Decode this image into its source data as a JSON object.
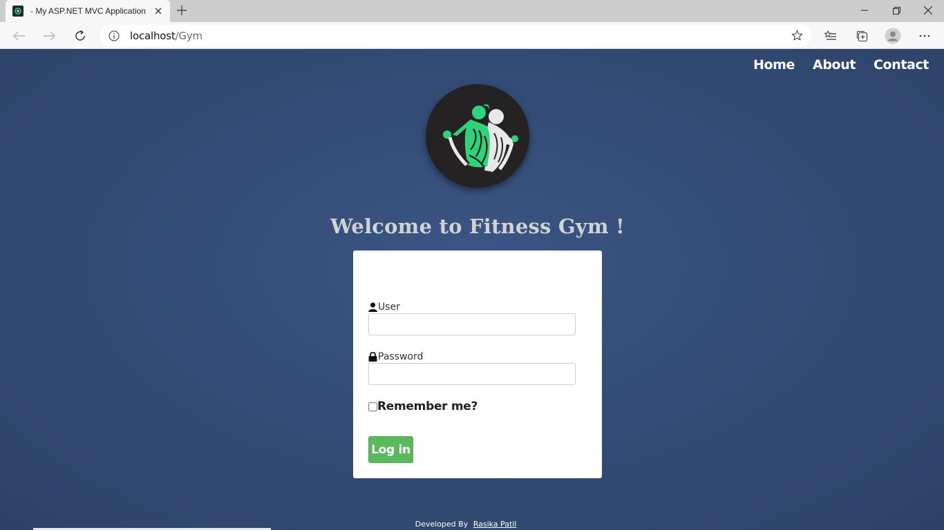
{
  "browser": {
    "tab_title": "- My ASP.NET MVC Application",
    "address_host": "localhost",
    "address_path": "/Gym"
  },
  "nav": {
    "home": "Home",
    "about": "About",
    "contact": "Contact"
  },
  "page": {
    "heading": "Welcome to Fitness Gym !"
  },
  "login": {
    "user_label": "User",
    "password_label": "Password",
    "remember_label": "Remember me?",
    "login_button": "Log in",
    "user_value": "",
    "password_value": ""
  },
  "footer": {
    "developed_by": "Developed By",
    "author": "Rasika Patil"
  },
  "colors": {
    "background": "#344d78",
    "login_button": "#5cb85c",
    "logo_accent": "#2ed47a"
  }
}
